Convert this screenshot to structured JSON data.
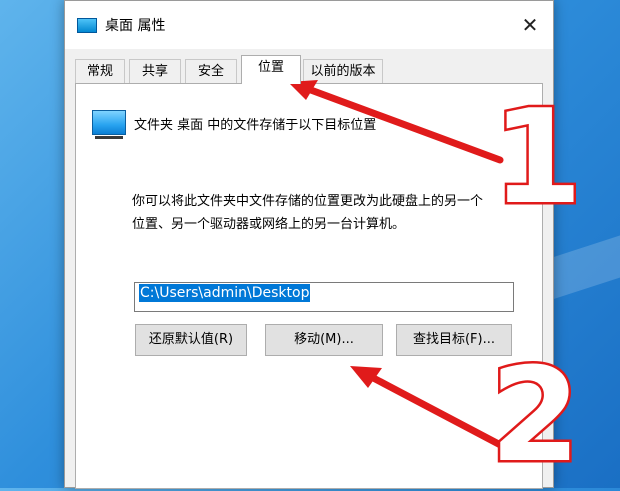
{
  "window": {
    "title": "桌面 属性",
    "close_label": "✕"
  },
  "tabs": [
    {
      "label": "常规",
      "active": false
    },
    {
      "label": "共享",
      "active": false
    },
    {
      "label": "安全",
      "active": false
    },
    {
      "label": "位置",
      "active": true
    },
    {
      "label": "以前的版本",
      "active": false
    }
  ],
  "location": {
    "info_text": "文件夹 桌面 中的文件存储于以下目标位置",
    "description_line1": "你可以将此文件夹中文件存储的位置更改为此硬盘上的另一个",
    "description_line2": "位置、另一个驱动器或网络上的另一台计算机。",
    "path_value": "C:\\Users\\admin\\Desktop"
  },
  "buttons": {
    "restore_default": "还原默认值(R)",
    "move": "移动(M)...",
    "find_target": "查找目标(F)..."
  },
  "annotations": {
    "step1": "1",
    "step2": "2",
    "color": "#e01b1b"
  },
  "icons": {
    "folder": "desktop-folder-icon",
    "close": "close-icon"
  }
}
